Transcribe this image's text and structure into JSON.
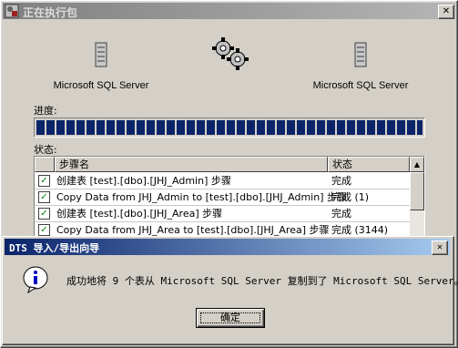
{
  "window": {
    "title": "正在执行包",
    "source_server": "Microsoft SQL Server",
    "dest_server": "Microsoft SQL Server",
    "progress_label": "进度:",
    "progress_value": 1.0,
    "status_label": "状态:"
  },
  "steps_table": {
    "columns": [
      "步骤名",
      "状态"
    ],
    "rows": [
      {
        "name": "创建表 [test].[dbo].[JHJ_Admin] 步骤",
        "status": "完成"
      },
      {
        "name": "Copy Data from JHJ_Admin to [test].[dbo].[JHJ_Admin] 步骤",
        "status": "完成 (1)"
      },
      {
        "name": "创建表 [test].[dbo].[JHJ_Area] 步骤",
        "status": "完成"
      },
      {
        "name": "Copy Data from JHJ_Area to [test].[dbo].[JHJ_Area] 步骤",
        "status": "完成 (3144)"
      }
    ]
  },
  "dialog": {
    "title": "DTS 导入/导出向导",
    "message": "成功地将 9 个表从 Microsoft SQL Server 复制到了 Microsoft SQL Server。",
    "ok_label": "确定"
  },
  "icons": {
    "app": "app-icon",
    "server": "database-server-icon",
    "gears": "gears-icon",
    "info": "info-icon"
  },
  "colors": {
    "progress": "#0a246a",
    "dialog_title": "#0a246a",
    "inactive_title": "#808080",
    "check": "#008000"
  }
}
